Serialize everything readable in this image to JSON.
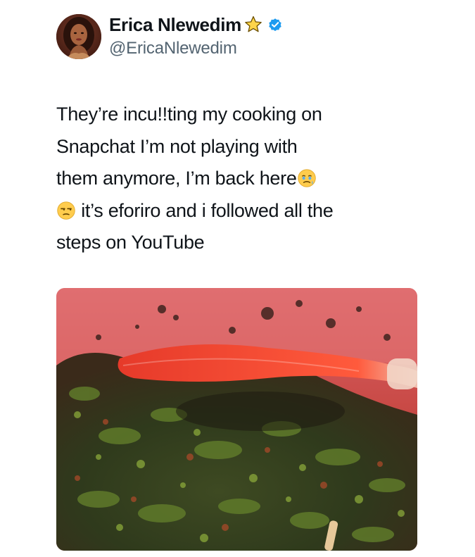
{
  "author": {
    "display_name": "Erica Nlewedim",
    "handle": "@EricaNlewedim",
    "badge_icon": "star-icon",
    "verified_icon": "verified-badge-icon",
    "verified_color": "#1d9bf0"
  },
  "tweet": {
    "line1_part1": "They’re inc",
    "line1_smudge": "u!!",
    "line1_part2": "ting my cooking on",
    "line2": "Snapchat I’m not playing with",
    "line3": "them anymore, I’m back here",
    "line3_emoji": "face-holding-back-tears-icon",
    "line4_emoji": "unamused-face-icon",
    "line4": " it’s eforiro and i followed all the",
    "line5": "steps on YouTube"
  },
  "media": {
    "icon": "cooked-vegetable-soup-photo"
  },
  "colors": {
    "text": "#0f1419",
    "secondary": "#536471",
    "background": "#ffffff"
  }
}
